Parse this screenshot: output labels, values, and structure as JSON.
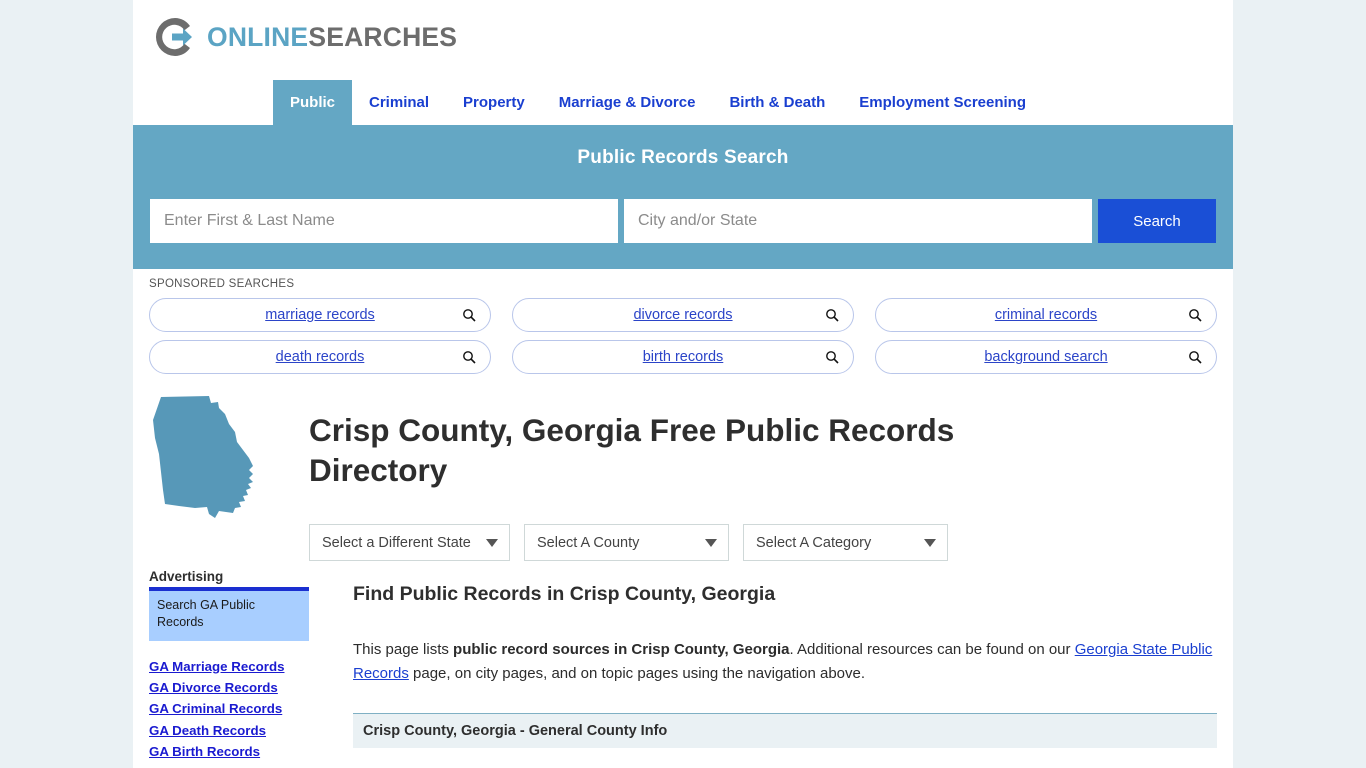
{
  "brand": {
    "name_part1": "ONLINE",
    "name_part2": "SEARCHES",
    "logo_icon": "circle-arrow-icon",
    "accent_teal": "#64a7c4",
    "accent_blue": "#1a4fd6",
    "gray": "#6d6d6d"
  },
  "nav": {
    "items": [
      {
        "label": "Public",
        "active": true
      },
      {
        "label": "Criminal",
        "active": false
      },
      {
        "label": "Property",
        "active": false
      },
      {
        "label": "Marriage & Divorce",
        "active": false
      },
      {
        "label": "Birth & Death",
        "active": false
      },
      {
        "label": "Employment Screening",
        "active": false
      }
    ]
  },
  "search": {
    "title": "Public Records Search",
    "name_placeholder": "Enter First & Last Name",
    "name_value": "",
    "city_placeholder": "City and/or State",
    "city_value": "",
    "button_label": "Search"
  },
  "sponsored": {
    "label": "SPONSORED SEARCHES",
    "items": [
      {
        "label": "marriage records",
        "icon": "search-icon"
      },
      {
        "label": "divorce records",
        "icon": "search-icon"
      },
      {
        "label": "criminal records",
        "icon": "search-icon"
      },
      {
        "label": "death records",
        "icon": "search-icon"
      },
      {
        "label": "birth records",
        "icon": "search-icon"
      },
      {
        "label": "background search",
        "icon": "search-icon"
      }
    ]
  },
  "hero": {
    "state_shape": "georgia-state-outline",
    "title": "Crisp County, Georgia Free Public Records Directory"
  },
  "filters": {
    "state": {
      "label": "Select a Different State",
      "caret": "chevron-down-icon"
    },
    "county": {
      "label": "Select A County",
      "caret": "chevron-down-icon"
    },
    "category": {
      "label": "Select A Category",
      "caret": "chevron-down-icon"
    }
  },
  "sidebar": {
    "advertising_heading": "Advertising",
    "ad_text": "Search GA Public Records",
    "links": [
      "GA Marriage Records",
      "GA Divorce Records",
      "GA Criminal Records",
      "GA Death Records",
      "GA Birth Records"
    ]
  },
  "main": {
    "section_title": "Find Public Records in Crisp County, Georgia",
    "intro_part1": "This page lists ",
    "intro_bold": "public record sources in Crisp County, Georgia",
    "intro_part2": ". Additional resources can be found on our ",
    "intro_link": "Georgia State Public Records",
    "intro_part3": " page, on city pages, and on topic pages using the navigation above.",
    "info_row_title": "Crisp County, Georgia - General County Info"
  }
}
